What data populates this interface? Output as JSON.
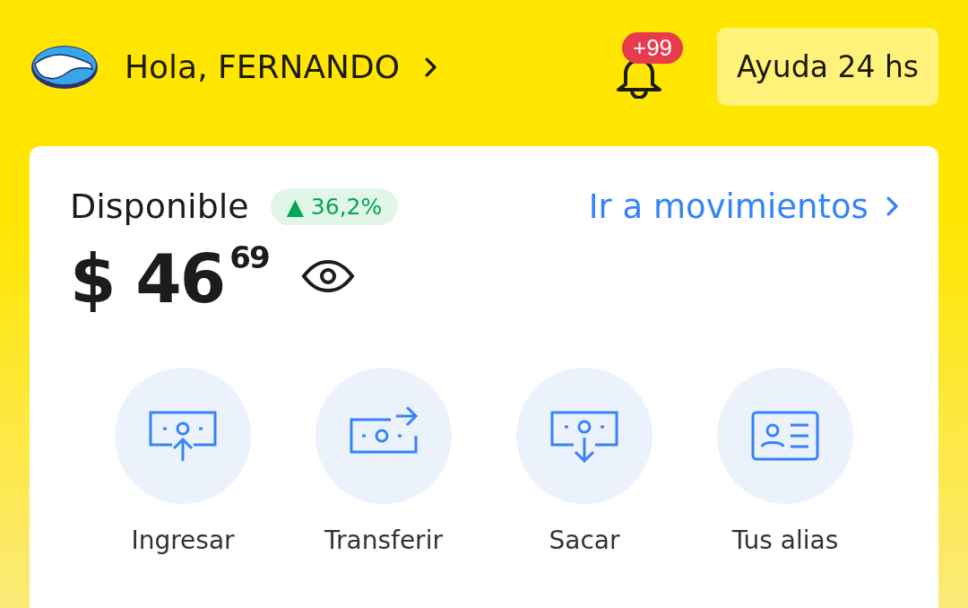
{
  "header": {
    "greeting": "Hola, FERNANDO",
    "notifications_badge": "+99",
    "help_button": "Ayuda 24 hs"
  },
  "account": {
    "title": "Disponible",
    "change_badge": "▲ 36,2%",
    "movements_link": "Ir a movimientos",
    "balance": {
      "currency": "$",
      "integer": "46",
      "cents": "69"
    }
  },
  "actions": [
    {
      "kind": "deposit",
      "label": "Ingresar"
    },
    {
      "kind": "transfer",
      "label": "Transferir"
    },
    {
      "kind": "withdraw",
      "label": "Sacar"
    },
    {
      "kind": "alias",
      "label": "Tus alias"
    }
  ]
}
